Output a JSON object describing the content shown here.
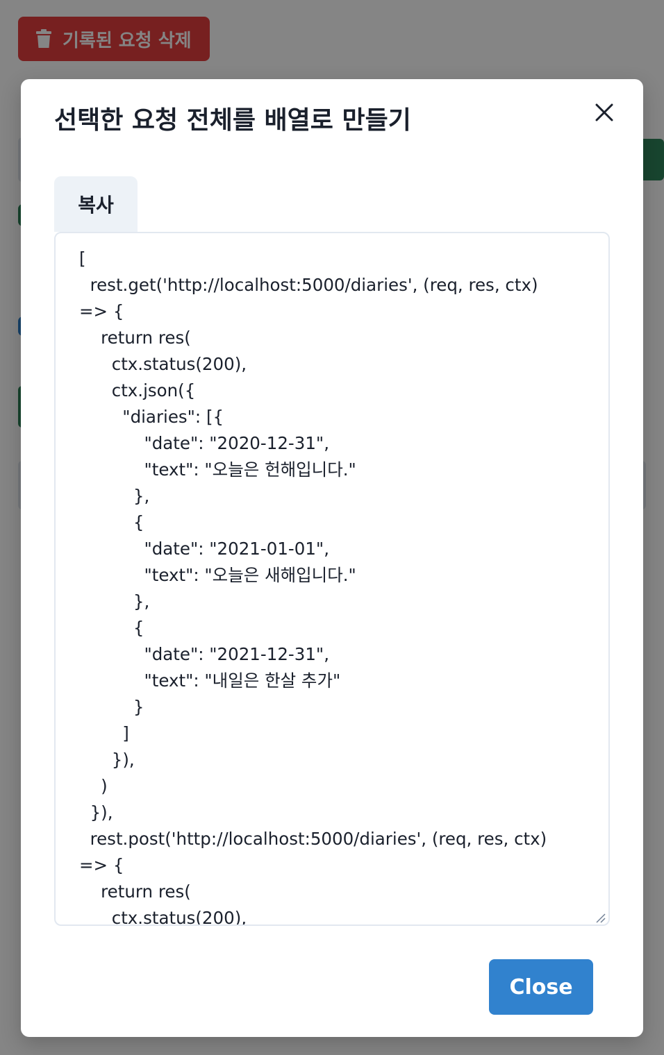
{
  "background": {
    "delete_button_label": "기록된 요청 삭제"
  },
  "modal": {
    "title": "선택한 요청 전체를 배열로 만들기",
    "copy_button_label": "복사",
    "code_text": "[\n  rest.get('http://localhost:5000/diaries', (req, res, ctx)\n=> {\n    return res(\n      ctx.status(200),\n      ctx.json({\n        \"diaries\": [{\n            \"date\": \"2020-12-31\",\n            \"text\": \"오늘은 헌해입니다.\"\n          },\n          {\n            \"date\": \"2021-01-01\",\n            \"text\": \"오늘은 새해입니다.\"\n          },\n          {\n            \"date\": \"2021-12-31\",\n            \"text\": \"내일은 한살 추가\"\n          }\n        ]\n      }),\n    )\n  }),\n  rest.post('http://localhost:5000/diaries', (req, res, ctx)\n=> {\n    return res(\n      ctx.status(200),",
    "close_button_label": "Close"
  },
  "colors": {
    "overlay": "rgba(0,0,0,0.48)",
    "delete_button": "#e53e3e",
    "close_button": "#3182ce",
    "copy_button": "#edf2f7"
  },
  "icons": {
    "delete": "trash-icon",
    "close": "close-icon"
  }
}
